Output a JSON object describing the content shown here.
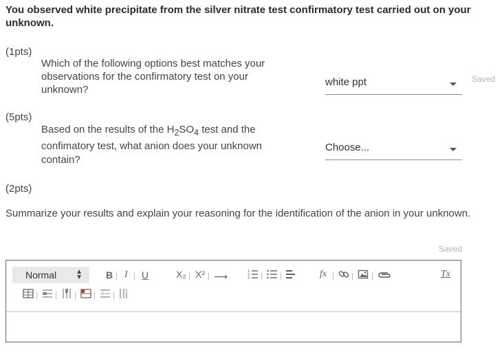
{
  "heading": "You observed white precipitate from the silver nitrate test confirmatory test carried out on your unknown.",
  "q1": {
    "pts": "(1pts)",
    "text": "Which of the following options best matches your observations for the confirmatory test on your unknown?",
    "selected": "white ppt",
    "status": "Saved"
  },
  "q2": {
    "pts": "(5pts)",
    "text_a": "Based on the results of the H",
    "sub1": "2",
    "text_b": "SO",
    "sub2": "4",
    "text_c": " test and the confimatory test, what anion does your unknown contain?",
    "selected": "Choose..."
  },
  "q3": {
    "pts": "(2pts)",
    "text": "Summarize your results and explain your reasoning for the identification of the anion in your unknown.",
    "status": "Saved",
    "editor": {
      "format": "Normal",
      "bold": "B",
      "italic": "I",
      "underline": "U",
      "subscript": "X₂",
      "superscript": "X²",
      "arrow": "⟶",
      "formula": "fx",
      "clear": "Tx"
    }
  },
  "colors": {
    "text": "#444444",
    "saved": "#b4b4b4",
    "border": "#666666"
  },
  "icons": [
    "arrow-icon",
    "ordered-list-icon",
    "bullet-list-icon",
    "align-icon",
    "formula-icon",
    "link-icon",
    "image-icon",
    "attachment-icon",
    "clear-format-icon",
    "insert-table-icon",
    "table-row-icon",
    "table-column-icon",
    "table-merge-icon",
    "table-delete-row-icon",
    "table-delete-column-icon"
  ]
}
